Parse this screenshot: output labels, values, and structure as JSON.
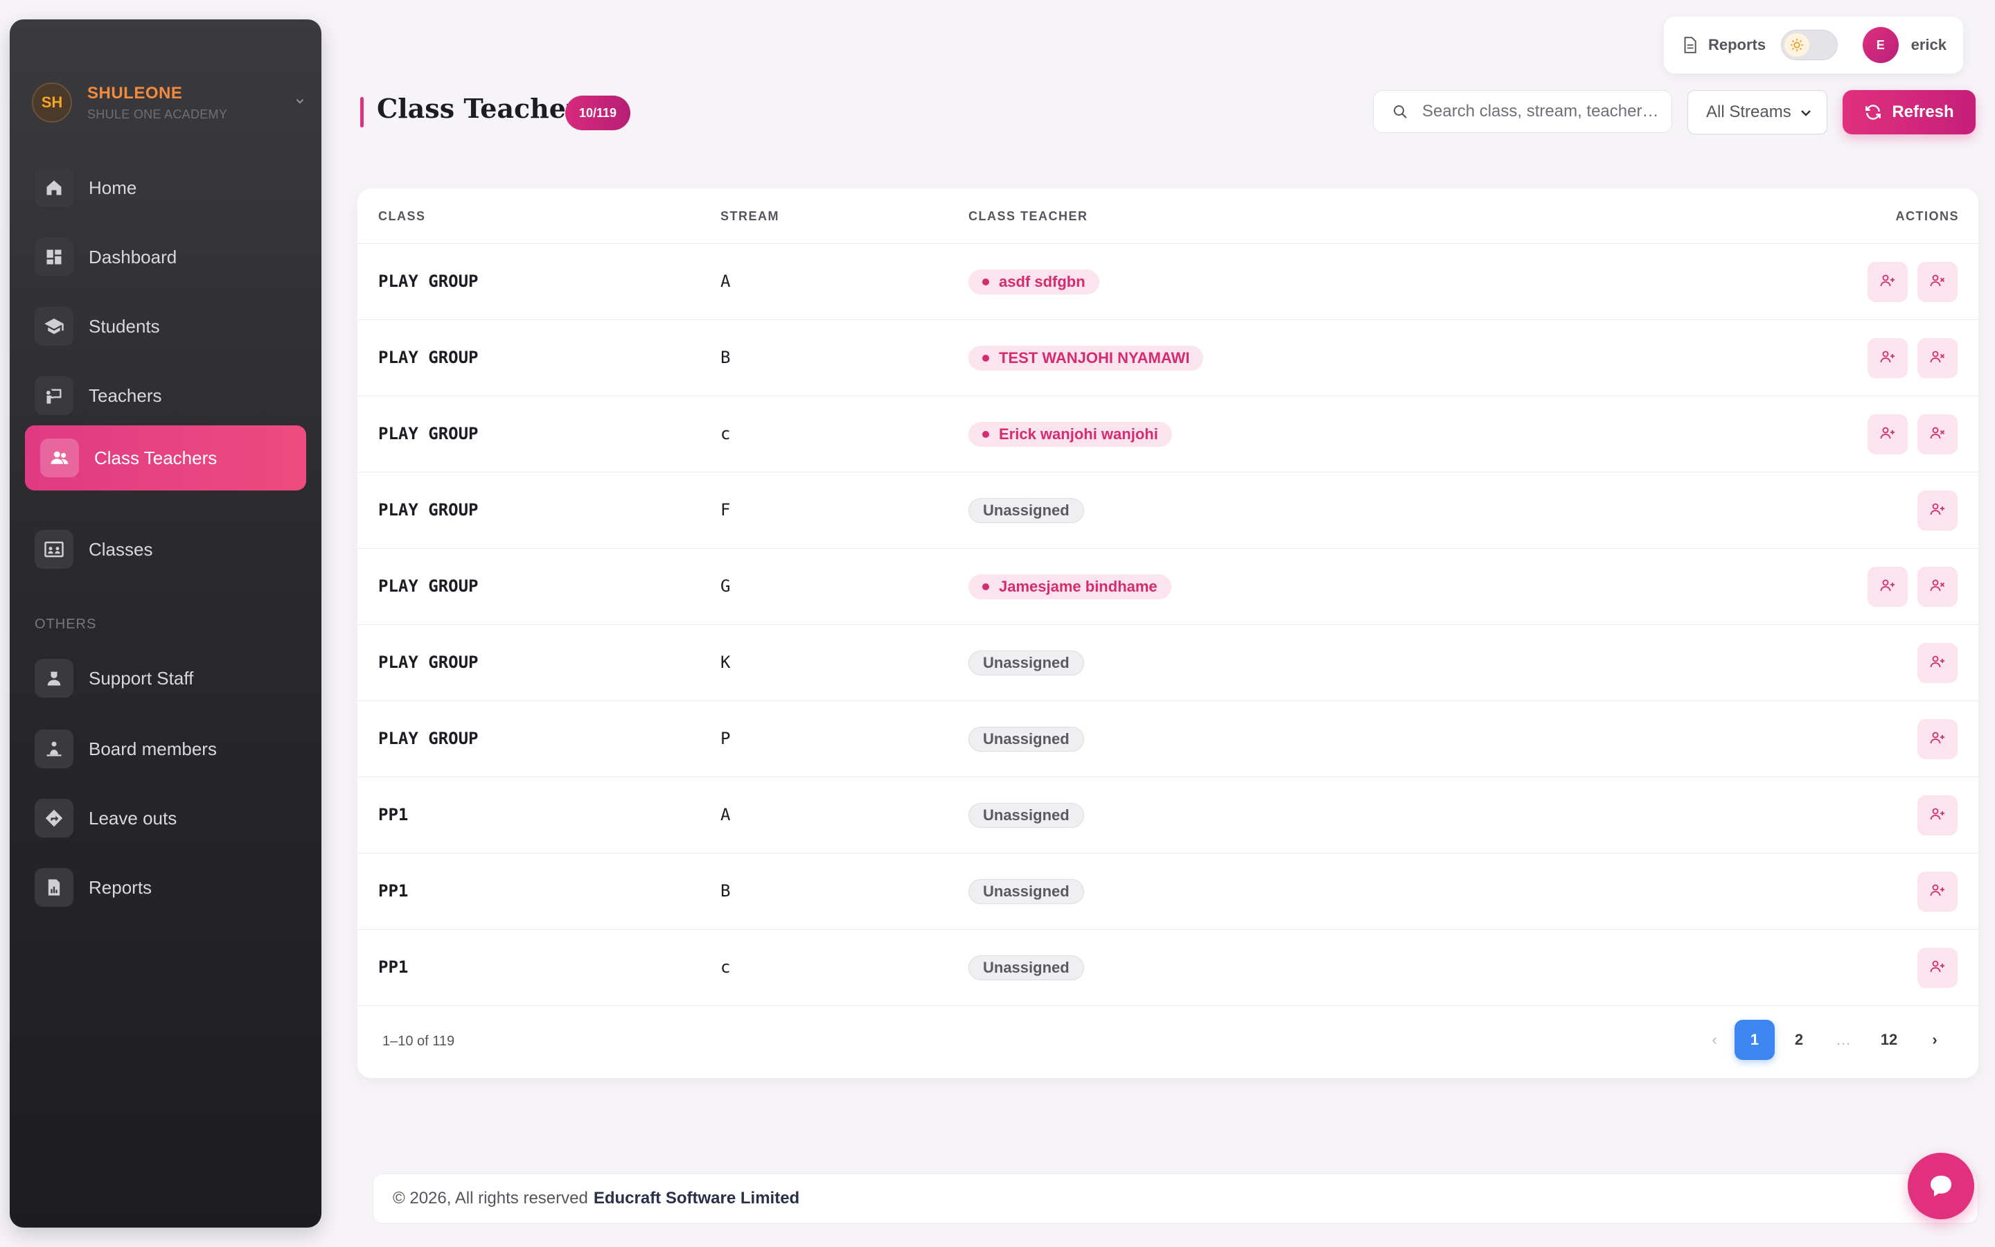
{
  "brand": {
    "initials": "SH",
    "name": "SHULEONE",
    "subtitle": "SHULE ONE ACADEMY"
  },
  "sidebar": {
    "items": [
      {
        "label": "Home",
        "icon": "home-icon"
      },
      {
        "label": "Dashboard",
        "icon": "dashboard-icon"
      },
      {
        "label": "Students",
        "icon": "graduation-cap-icon"
      },
      {
        "label": "Teachers",
        "icon": "teacher-icon"
      },
      {
        "label": "Class Teachers",
        "icon": "users-icon",
        "active": true
      },
      {
        "label": "Classes",
        "icon": "classroom-icon"
      }
    ],
    "others_label": "OTHERS",
    "others": [
      {
        "label": "Support Staff",
        "icon": "staff-icon"
      },
      {
        "label": "Board members",
        "icon": "board-icon"
      },
      {
        "label": "Leave outs",
        "icon": "directions-icon"
      },
      {
        "label": "Reports",
        "icon": "report-icon"
      }
    ]
  },
  "topbar": {
    "reports_label": "Reports",
    "theme_toggle": "light",
    "user_initial": "E",
    "user_name": "erick"
  },
  "header": {
    "title": "Class Teachers",
    "count_badge": "10/119",
    "search_placeholder": "Search class, stream, teacher…",
    "stream_filter": "All Streams",
    "refresh_label": "Refresh"
  },
  "table": {
    "columns": {
      "class": "CLASS",
      "stream": "STREAM",
      "teacher": "CLASS TEACHER",
      "actions": "ACTIONS"
    },
    "rows": [
      {
        "class": "PLAY GROUP",
        "stream": "A",
        "teacher": "asdf sdfgbn",
        "assigned": true
      },
      {
        "class": "PLAY GROUP",
        "stream": "B",
        "teacher": "TEST WANJOHI NYAMAWI",
        "assigned": true
      },
      {
        "class": "PLAY GROUP",
        "stream": "c",
        "teacher": "Erick wanjohi wanjohi",
        "assigned": true
      },
      {
        "class": "PLAY GROUP",
        "stream": "F",
        "teacher": "Unassigned",
        "assigned": false
      },
      {
        "class": "PLAY GROUP",
        "stream": "G",
        "teacher": "Jamesjame bindhame",
        "assigned": true
      },
      {
        "class": "PLAY GROUP",
        "stream": "K",
        "teacher": "Unassigned",
        "assigned": false
      },
      {
        "class": "PLAY GROUP",
        "stream": "P",
        "teacher": "Unassigned",
        "assigned": false
      },
      {
        "class": "PP1",
        "stream": "A",
        "teacher": "Unassigned",
        "assigned": false
      },
      {
        "class": "PP1",
        "stream": "B",
        "teacher": "Unassigned",
        "assigned": false
      },
      {
        "class": "PP1",
        "stream": "c",
        "teacher": "Unassigned",
        "assigned": false
      }
    ]
  },
  "pagination": {
    "info": "1–10 of 119",
    "pages": [
      "1",
      "2",
      "…",
      "12"
    ],
    "current": "1",
    "prev": "‹",
    "next": "›"
  },
  "footer": {
    "text": "© 2026, All rights reserved",
    "company": "Educraft Software Limited"
  },
  "colors": {
    "accent": "#e0307e",
    "page_active": "#3d86f0",
    "sidebar_bg": "#2a2a2d"
  }
}
